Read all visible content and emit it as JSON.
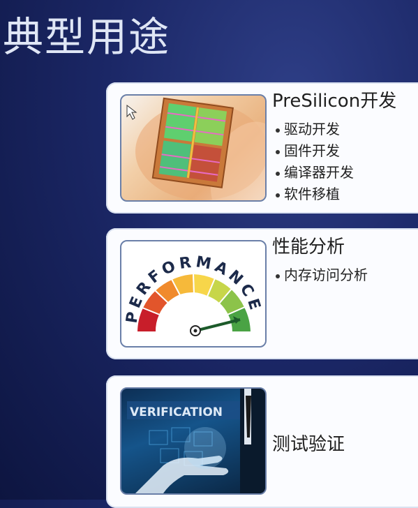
{
  "page": {
    "title": "典型用途"
  },
  "cards": [
    {
      "heading": "PreSilicon开发",
      "items": [
        "驱动开发",
        "固件开发",
        "编译器开发",
        "软件移植"
      ],
      "image": "chip-on-finger"
    },
    {
      "heading": "性能分析",
      "items": [
        "内存访问分析"
      ],
      "image": "performance-gauge",
      "gauge_text": "PERFORMANCE"
    },
    {
      "heading": "测试验证",
      "items": [],
      "image": "verification-touch",
      "image_text": "VERIFICATION"
    }
  ]
}
